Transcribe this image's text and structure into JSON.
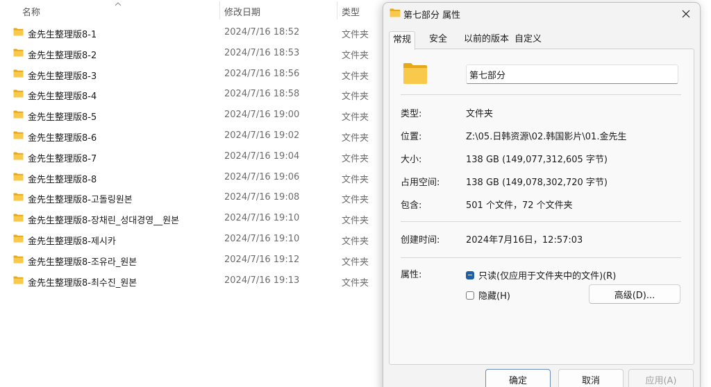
{
  "explorer": {
    "columns": {
      "name": "名称",
      "sort_indicator": "^",
      "date": "修改日期",
      "type": "类型"
    },
    "files": [
      {
        "name": "金先生整理版8-1",
        "date": "2024/7/16 18:52",
        "type": "文件夹"
      },
      {
        "name": "金先生整理版8-2",
        "date": "2024/7/16 18:53",
        "type": "文件夹"
      },
      {
        "name": "金先生整理版8-3",
        "date": "2024/7/16 18:56",
        "type": "文件夹"
      },
      {
        "name": "金先生整理版8-4",
        "date": "2024/7/16 18:58",
        "type": "文件夹"
      },
      {
        "name": "金先生整理版8-5",
        "date": "2024/7/16 19:00",
        "type": "文件夹"
      },
      {
        "name": "金先生整理版8-6",
        "date": "2024/7/16 19:02",
        "type": "文件夹"
      },
      {
        "name": "金先生整理版8-7",
        "date": "2024/7/16 19:04",
        "type": "文件夹"
      },
      {
        "name": "金先生整理版8-8",
        "date": "2024/7/16 19:06",
        "type": "文件夹"
      },
      {
        "name": "金先生整理版8-고돌링원본",
        "date": "2024/7/16 19:08",
        "type": "文件夹"
      },
      {
        "name": "金先生整理版8-장채린_성대경영__원본",
        "date": "2024/7/16 19:10",
        "type": "文件夹"
      },
      {
        "name": "金先生整理版8-제시카",
        "date": "2024/7/16 19:10",
        "type": "文件夹"
      },
      {
        "name": "金先生整理版8-조유라_원본",
        "date": "2024/7/16 19:12",
        "type": "文件夹"
      },
      {
        "name": "金先生整理版8-최수진_원본",
        "date": "2024/7/16 19:13",
        "type": "文件夹"
      }
    ]
  },
  "dialog": {
    "title": "第七部分 属性",
    "tabs": [
      "常规",
      "安全",
      "以前的版本",
      "自定义"
    ],
    "active_tab": "常规",
    "folder_name": "第七部分",
    "properties": {
      "type_label": "类型:",
      "type_value": "文件夹",
      "location_label": "位置:",
      "location_value": "Z:\\05.日韩资源\\02.韩国影片\\01.金先生",
      "size_label": "大小:",
      "size_value": "138 GB (149,077,312,605 字节)",
      "disk_label": "占用空间:",
      "disk_value": "138 GB (149,078,302,720 字节)",
      "contains_label": "包含:",
      "contains_value": "501 个文件，72 个文件夹",
      "created_label": "创建时间:",
      "created_value": "2024年7月16日，12:57:03",
      "attributes_label": "属性:"
    },
    "attributes": {
      "readonly_label": "只读(仅应用于文件夹中的文件)(R)",
      "readonly_state": "indeterminate",
      "hidden_label": "隐藏(H)",
      "hidden_state": "unchecked",
      "advanced_button": "高级(D)..."
    },
    "buttons": {
      "ok": "确定",
      "cancel": "取消",
      "apply": "应用(A)"
    }
  },
  "colors": {
    "folder_yellow": "#f8c94a",
    "folder_back": "#e6a817",
    "accent_blue": "#1f5fa8"
  },
  "icons": {
    "folder": "folder-icon",
    "close": "close-icon",
    "sort": "sort-up-icon"
  }
}
